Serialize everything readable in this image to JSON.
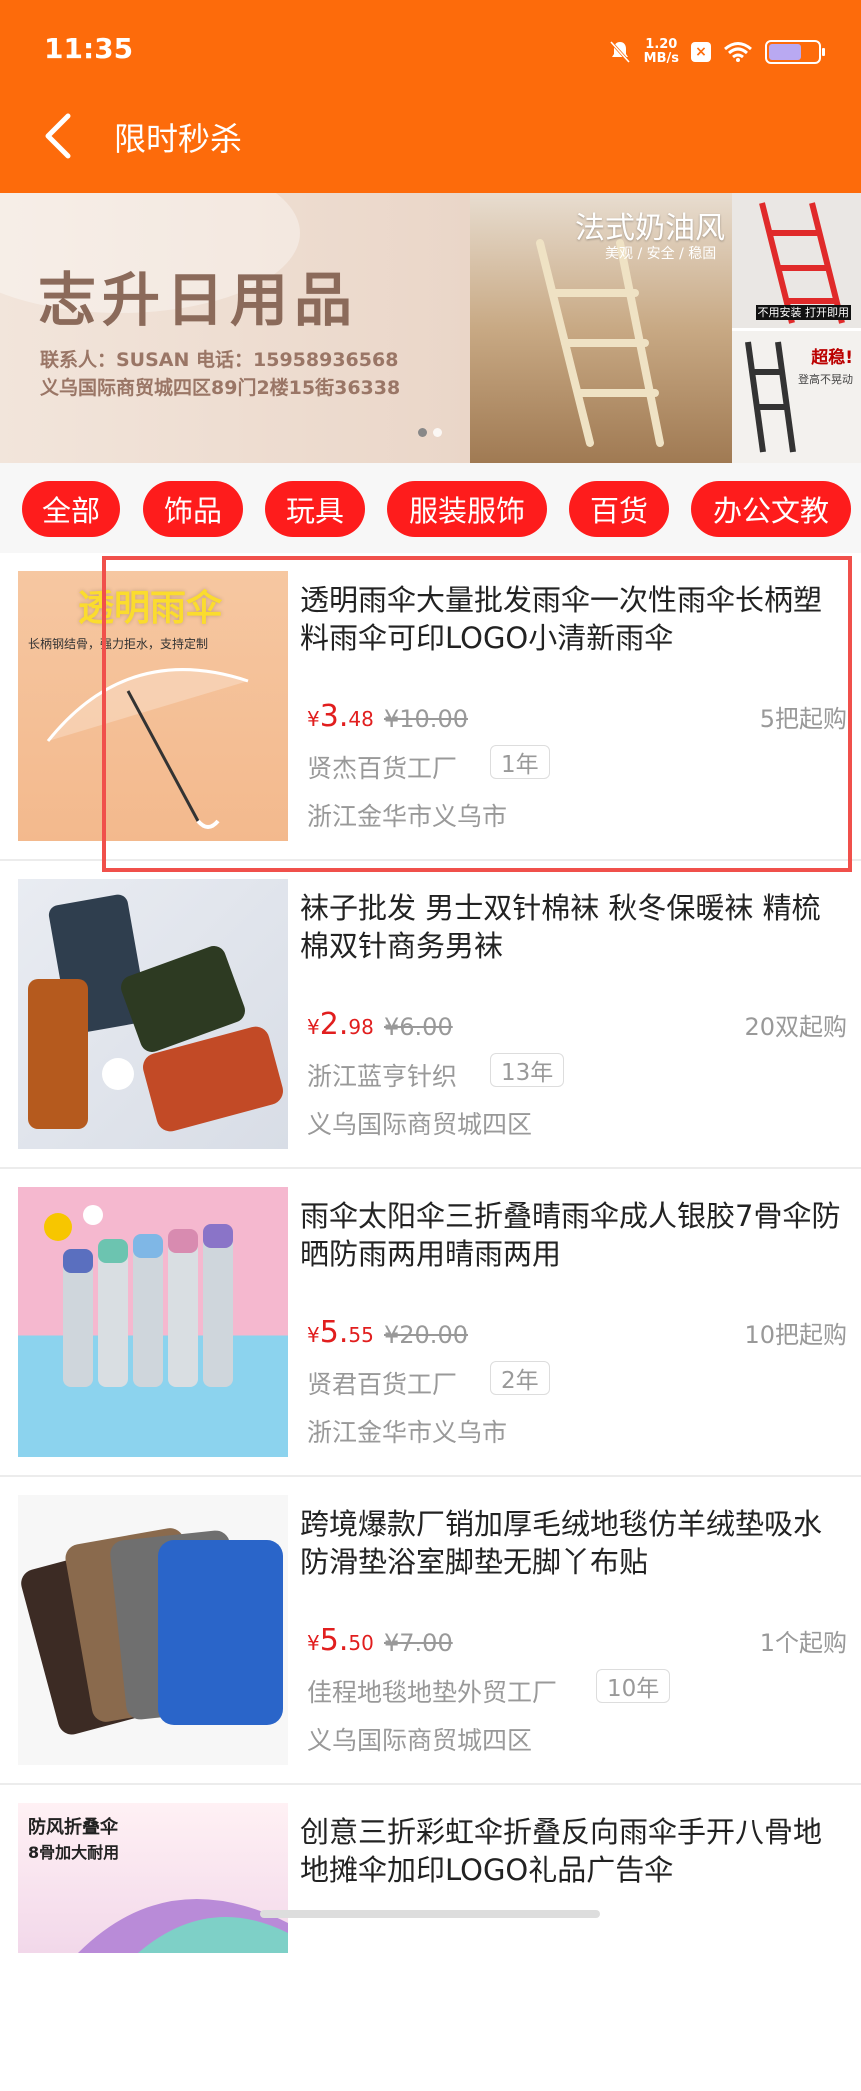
{
  "status_bar": {
    "time": "11:35",
    "net_speed_top": "1.20",
    "net_speed_bottom": "MB/s"
  },
  "header": {
    "title": "限时秒杀"
  },
  "banner": {
    "name": "志升日用品",
    "contact": "联系人：SUSAN   电话：15958936568",
    "address": "义乌国际商贸城四区89门2楼15街36338",
    "slogan": "法式奶油风",
    "slogan_sub": "美观 / 安全 / 稳固",
    "side_text_1": "不用安装 打开即用",
    "side_text_2": "超稳!",
    "side_text_3": "登高不晃动"
  },
  "categories": [
    "全部",
    "饰品",
    "玩具",
    "服装服饰",
    "百货",
    "办公文教"
  ],
  "products": [
    {
      "thumb_label": "透明雨伞",
      "thumb_sub": "长柄钢结骨，强力拒水，支持定制",
      "title": "透明雨伞大量批发雨伞一次性雨伞长柄塑料雨伞可印LOGO小清新雨伞",
      "price_yen": "¥",
      "price_int": "3.",
      "price_dec": "48",
      "orig_price": "¥10.00",
      "moq": "5把起购",
      "seller": "贤杰百货工厂",
      "years": "1年",
      "location": "浙江金华市义乌市"
    },
    {
      "title": "袜子批发 男士双针棉袜 秋冬保暖袜 精梳棉双针商务男袜",
      "price_yen": "¥",
      "price_int": "2.",
      "price_dec": "98",
      "orig_price": "¥6.00",
      "moq": "20双起购",
      "seller": "浙江蓝亨针织",
      "years": "13年",
      "location": "义乌国际商贸城四区"
    },
    {
      "title": "雨伞太阳伞三折叠晴雨伞成人银胶7骨伞防晒防雨两用晴雨两用",
      "price_yen": "¥",
      "price_int": "5.",
      "price_dec": "55",
      "orig_price": "¥20.00",
      "moq": "10把起购",
      "seller": "贤君百货工厂",
      "years": "2年",
      "location": "浙江金华市义乌市"
    },
    {
      "title": "跨境爆款厂销加厚毛绒地毯仿羊绒垫吸水防滑垫浴室脚垫无脚丫布贴",
      "price_yen": "¥",
      "price_int": "5.",
      "price_dec": "50",
      "orig_price": "¥7.00",
      "moq": "1个起购",
      "seller": "佳程地毯地垫外贸工厂",
      "years": "10年",
      "location": "义乌国际商贸城四区"
    },
    {
      "thumb_label": "防风折叠伞",
      "thumb_sub": "8骨加大耐用",
      "title": "创意三折彩虹伞折叠反向雨伞手开八骨地地摊伞加印LOGO礼品广告伞"
    }
  ]
}
